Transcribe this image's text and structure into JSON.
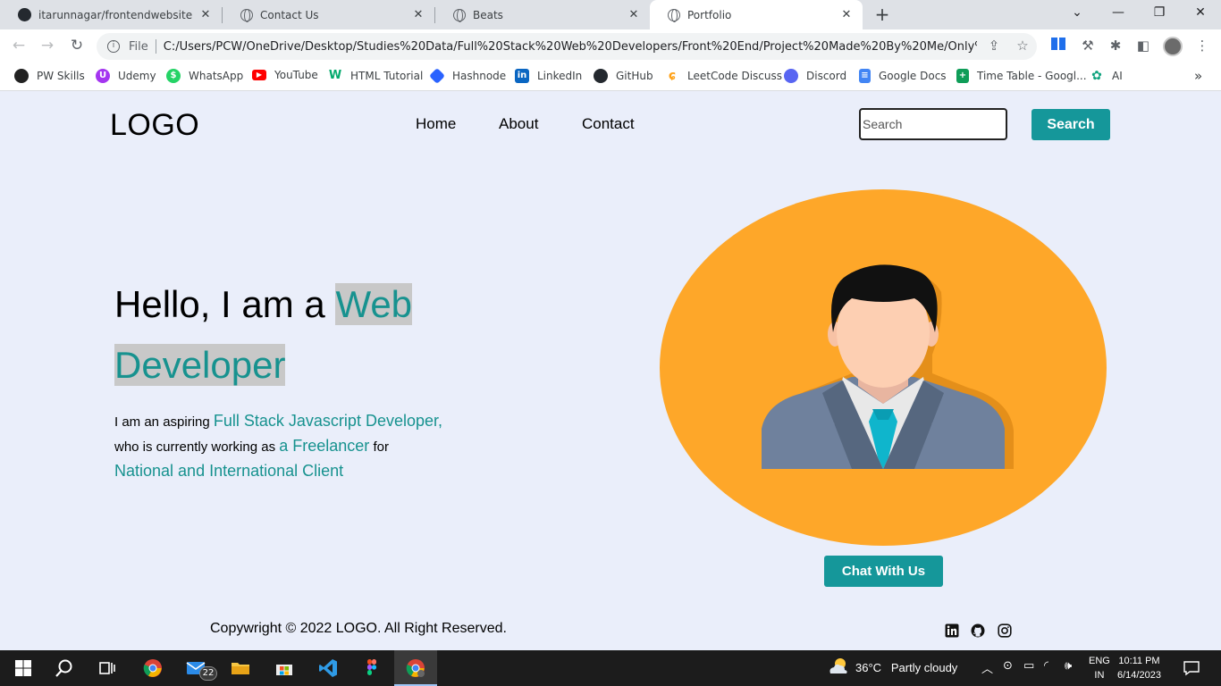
{
  "browser": {
    "tabs": [
      {
        "title": "itarunnagar/frontendwebsite",
        "icon": "github-icon",
        "active": false
      },
      {
        "title": "Contact Us",
        "icon": "globe-icon",
        "active": false
      },
      {
        "title": "Beats",
        "icon": "globe-icon",
        "active": false
      },
      {
        "title": "Portfolio",
        "icon": "globe-icon",
        "active": true
      }
    ],
    "new_tab": "+",
    "address": {
      "scheme": "File",
      "url": "C:/Users/PCW/OneDrive/Desktop/Studies%20Data/Full%20Stack%20Web%20Developers/Front%20End/Project%20Made%20By%20Me/Only%20S..."
    },
    "bookmarks": [
      {
        "label": "PW Skills",
        "icon": "pwskills-icon",
        "color": "#222222"
      },
      {
        "label": "Udemy",
        "icon": "udemy-icon",
        "color": "#a435f0"
      },
      {
        "label": "WhatsApp",
        "icon": "whatsapp-icon",
        "color": "#25d366"
      },
      {
        "label": "YouTube",
        "icon": "youtube-icon",
        "color": "#ff0000"
      },
      {
        "label": "HTML Tutorial",
        "icon": "w3schools-icon",
        "color": "#04aa6d"
      },
      {
        "label": "Hashnode",
        "icon": "hashnode-icon",
        "color": "#2962ff"
      },
      {
        "label": "LinkedIn",
        "icon": "linkedin-icon",
        "color": "#0a66c2"
      },
      {
        "label": "GitHub",
        "icon": "github-icon",
        "color": "#24292f"
      },
      {
        "label": "LeetCode Discuss",
        "icon": "leetcode-icon",
        "color": "#ffa116"
      },
      {
        "label": "Discord",
        "icon": "discord-icon",
        "color": "#5865f2"
      },
      {
        "label": "Google Docs",
        "icon": "google-docs-icon",
        "color": "#4285f4"
      },
      {
        "label": "Time Table - Googl...",
        "icon": "google-sheets-icon",
        "color": "#0f9d58"
      },
      {
        "label": "AI",
        "icon": "openai-icon",
        "color": "#10a37f"
      }
    ]
  },
  "site": {
    "logo": "LOGO",
    "nav": [
      "Home",
      "About",
      "Contact"
    ],
    "search": {
      "placeholder": "Search",
      "button": "Search"
    },
    "hero": {
      "greeting": "Hello, I am a ",
      "role": "Web Developer",
      "line1_prefix": "I am an aspiring ",
      "line1_accent": "Full Stack Javascript Developer,",
      "line2_prefix": "who is currently working as ",
      "line2_accent": "a Freelancer",
      "line2_suffix": " for",
      "line3_accent": "National and International Client"
    },
    "chat_button": "Chat With Us",
    "footer": {
      "copyright": "Copywright © 2022 LOGO. All Right Reserved.",
      "social": [
        "linkedin-icon",
        "github-icon",
        "instagram-icon"
      ]
    },
    "colors": {
      "accent": "#15979a",
      "page_bg": "#eaeefa",
      "avatar_bg": "#fea729"
    }
  },
  "taskbar": {
    "weather": {
      "temp": "36°C",
      "condition": "Partly cloudy"
    },
    "mail_badge": "22",
    "language": [
      "ENG",
      "IN"
    ],
    "time": "10:11 PM",
    "date": "6/14/2023"
  }
}
